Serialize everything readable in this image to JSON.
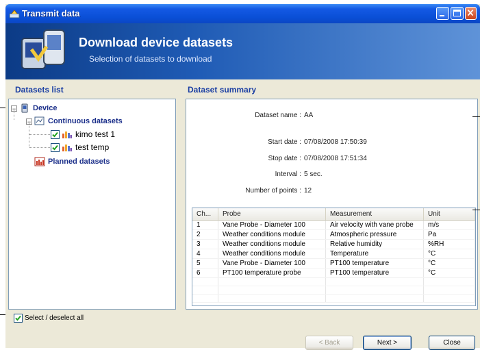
{
  "window": {
    "title": "Transmit data"
  },
  "banner": {
    "title": "Download device datasets",
    "subtitle": "Selection of datasets to download"
  },
  "datasets_list": {
    "label": "Datasets list",
    "root": "Device",
    "continuous": "Continuous datasets",
    "items": [
      {
        "label": "kimo test 1",
        "checked": true
      },
      {
        "label": "test temp",
        "checked": true
      }
    ],
    "planned": "Planned datasets"
  },
  "summary": {
    "label": "Dataset summary",
    "fields": {
      "name_label": "Dataset name :",
      "name_value": "AA",
      "start_label": "Start date :",
      "start_value": "07/08/2008 17:50:39",
      "stop_label": "Stop date :",
      "stop_value": "07/08/2008 17:51:34",
      "interval_label": "Interval :",
      "interval_value": "5 sec.",
      "points_label": "Number of points :",
      "points_value": "12"
    },
    "table": {
      "headers": [
        "Ch...",
        "Probe",
        "Measurement",
        "Unit"
      ],
      "rows": [
        [
          "1",
          "Vane Probe - Diameter 100",
          "Air velocity with vane probe",
          "m/s"
        ],
        [
          "2",
          "Weather conditions module",
          "Atmospheric pressure",
          "Pa"
        ],
        [
          "3",
          "Weather conditions module",
          "Relative humidity",
          "%RH"
        ],
        [
          "4",
          "Weather conditions module",
          "Temperature",
          "°C"
        ],
        [
          "5",
          "Vane Probe - Diameter 100",
          "PT100 temperature",
          "°C"
        ],
        [
          "6",
          "PT100 temperature probe",
          "PT100 temperature",
          "°C"
        ]
      ]
    }
  },
  "select_all": {
    "label": "Select / deselect all",
    "checked": true
  },
  "buttons": {
    "back": "< Back",
    "next": "Next >",
    "close": "Close"
  }
}
